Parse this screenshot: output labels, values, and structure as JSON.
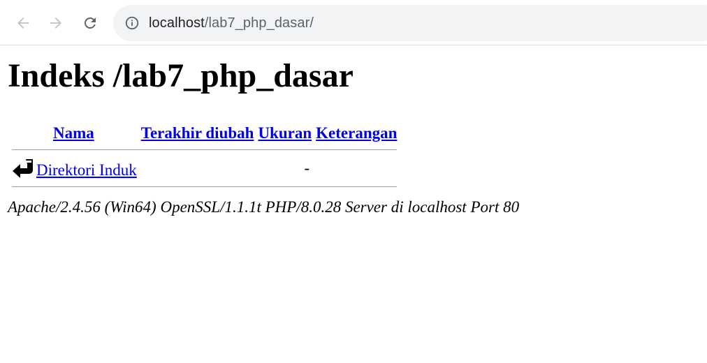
{
  "browser": {
    "url_host": "localhost",
    "url_path": "/lab7_php_dasar/"
  },
  "page": {
    "title": "Indeks /lab7_php_dasar",
    "columns": {
      "name": "Nama",
      "modified": "Terakhir diubah",
      "size": "Ukuran",
      "description": "Keterangan"
    },
    "rows": [
      {
        "name": "Direktori Induk",
        "modified": "",
        "size": "-",
        "description": ""
      }
    ],
    "footer": "Apache/2.4.56 (Win64) OpenSSL/1.1.1t PHP/8.0.28 Server di localhost Port 80"
  },
  "colors": {
    "link": "#0000ee",
    "omnibox_bg": "#f1f3f4"
  }
}
